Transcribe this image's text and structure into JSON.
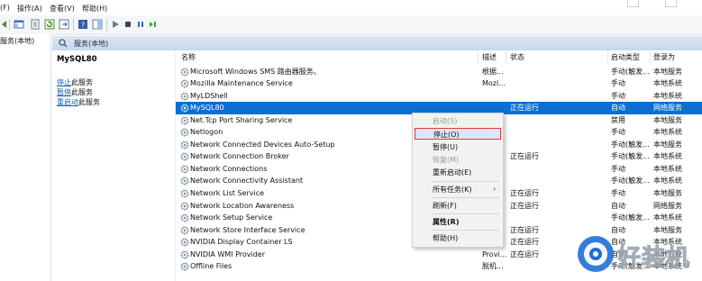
{
  "menu": {
    "items": [
      "(F)",
      "操作(A)",
      "查看(V)",
      "帮助(H)"
    ]
  },
  "tree": {
    "root_label": "服务(本地)"
  },
  "header": {
    "title": "服务(本地)"
  },
  "description": {
    "title": "MySQL80",
    "stop_link": "停止",
    "stop_suffix": "此服务",
    "pause_link": "暂停",
    "pause_suffix": "此服务",
    "restart_link": "重启动",
    "restart_suffix": "此服务"
  },
  "columns": {
    "name": "名称",
    "desc": "描述",
    "status": "状态",
    "startup": "启动类型",
    "logon": "登录为"
  },
  "services": [
    {
      "name": "Microsoft Windows SMS 路由器服务。",
      "desc": "根据...",
      "status": "",
      "startup": "手动(触发...",
      "logon": "本地服务"
    },
    {
      "name": "Mozilla Maintenance Service",
      "desc": "Mozi...",
      "status": "",
      "startup": "手动",
      "logon": "本地系统"
    },
    {
      "name": "MyLDShell",
      "desc": "",
      "status": "",
      "startup": "手动",
      "logon": "本地系统"
    },
    {
      "name": "MySQL80",
      "desc": "",
      "status": "正在运行",
      "startup": "自动",
      "logon": "网络服务"
    },
    {
      "name": "Net.Tcp Port Sharing Service",
      "desc": "",
      "status": "",
      "startup": "禁用",
      "logon": "本地服务"
    },
    {
      "name": "Netlogon",
      "desc": "",
      "status": "",
      "startup": "手动",
      "logon": "本地系统"
    },
    {
      "name": "Network Connected Devices Auto-Setup",
      "desc": "",
      "status": "",
      "startup": "手动(触发...",
      "logon": "本地服务"
    },
    {
      "name": "Network Connection Broker",
      "desc": "",
      "status": "正在运行",
      "startup": "手动(触发...",
      "logon": "本地系统"
    },
    {
      "name": "Network Connections",
      "desc": "",
      "status": "",
      "startup": "手动",
      "logon": "本地系统"
    },
    {
      "name": "Network Connectivity Assistant",
      "desc": "",
      "status": "",
      "startup": "手动(触发...",
      "logon": "本地系统"
    },
    {
      "name": "Network List Service",
      "desc": "",
      "status": "正在运行",
      "startup": "手动",
      "logon": "本地服务"
    },
    {
      "name": "Network Location Awareness",
      "desc": "",
      "status": "正在运行",
      "startup": "自动",
      "logon": "网络服务"
    },
    {
      "name": "Network Setup Service",
      "desc": "",
      "status": "",
      "startup": "手动(触发...",
      "logon": "本地系统"
    },
    {
      "name": "Network Store Interface Service",
      "desc": "",
      "status": "正在运行",
      "startup": "自动",
      "logon": "本地服务"
    },
    {
      "name": "NVIDIA Display Container LS",
      "desc": "",
      "status": "正在运行",
      "startup": "自动",
      "logon": "本地系统"
    },
    {
      "name": "NVIDIA WMI Provider",
      "desc": "Provi...",
      "status": "正在运行",
      "startup": "自动",
      "logon": "本地系统"
    },
    {
      "name": "Offline Files",
      "desc": "脱机...",
      "status": "",
      "startup": "手动(触发...",
      "logon": "本地系统"
    }
  ],
  "context_menu": {
    "start": "启动(S)",
    "stop": "停止(O)",
    "pause": "暂停(U)",
    "resume": "恢复(M)",
    "restart": "重新启动(E)",
    "all_tasks": "所有任务(K)",
    "refresh": "刷新(F)",
    "properties": "属性(R)",
    "help": "帮助(H)"
  },
  "watermark": {
    "text": "好装机"
  },
  "colors": {
    "selection": "#0a6fd2",
    "highlight_border": "#e0393b",
    "link": "#1a5fb4"
  }
}
